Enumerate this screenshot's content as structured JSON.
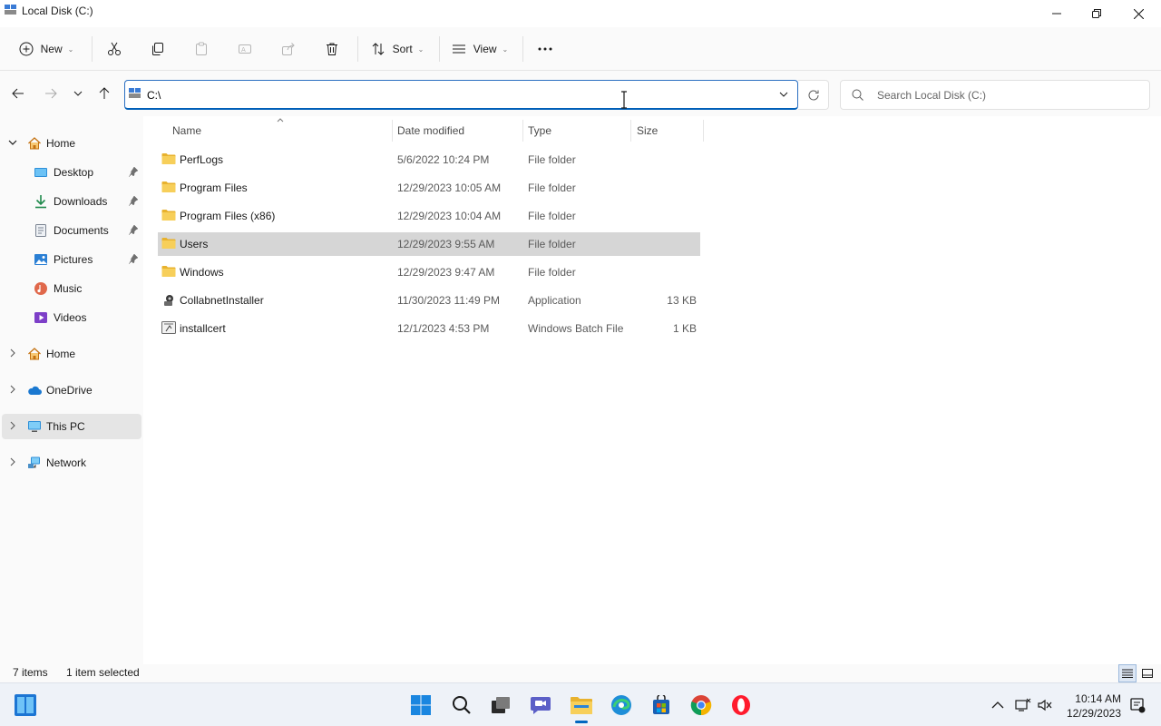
{
  "window": {
    "title": "Local Disk (C:)"
  },
  "toolbar": {
    "new_label": "New",
    "sort_label": "Sort",
    "view_label": "View"
  },
  "address": {
    "path": "C:\\",
    "search_placeholder": "Search Local Disk (C:)"
  },
  "sidebar": {
    "items": [
      {
        "label": "Home"
      },
      {
        "label": "Desktop"
      },
      {
        "label": "Downloads"
      },
      {
        "label": "Documents"
      },
      {
        "label": "Pictures"
      },
      {
        "label": "Music"
      },
      {
        "label": "Videos"
      },
      {
        "label": "Home"
      },
      {
        "label": "OneDrive"
      },
      {
        "label": "This PC"
      },
      {
        "label": "Network"
      }
    ]
  },
  "columns": {
    "name": "Name",
    "date": "Date modified",
    "type": "Type",
    "size": "Size"
  },
  "files": [
    {
      "name": "PerfLogs",
      "date": "5/6/2022 10:24 PM",
      "type": "File folder",
      "size": "",
      "icon": "folder-icon"
    },
    {
      "name": "Program Files",
      "date": "12/29/2023 10:05 AM",
      "type": "File folder",
      "size": "",
      "icon": "folder-icon"
    },
    {
      "name": "Program Files (x86)",
      "date": "12/29/2023 10:04 AM",
      "type": "File folder",
      "size": "",
      "icon": "folder-icon"
    },
    {
      "name": "Users",
      "date": "12/29/2023 9:55 AM",
      "type": "File folder",
      "size": "",
      "icon": "folder-icon",
      "selected": true
    },
    {
      "name": "Windows",
      "date": "12/29/2023 9:47 AM",
      "type": "File folder",
      "size": "",
      "icon": "folder-icon"
    },
    {
      "name": "CollabnetInstaller",
      "date": "11/30/2023 11:49 PM",
      "type": "Application",
      "size": "13 KB",
      "icon": "application-icon"
    },
    {
      "name": "installcert",
      "date": "12/1/2023 4:53 PM",
      "type": "Windows Batch File",
      "size": "1 KB",
      "icon": "batch-file-icon"
    }
  ],
  "status": {
    "item_count": "7 items",
    "selection": "1 item selected"
  },
  "taskbar": {
    "time": "10:14 AM",
    "date": "12/29/2023"
  },
  "colors": {
    "accent": "#005fb8",
    "folder": "#f4c542",
    "selected_row": "#d6d6d6"
  }
}
